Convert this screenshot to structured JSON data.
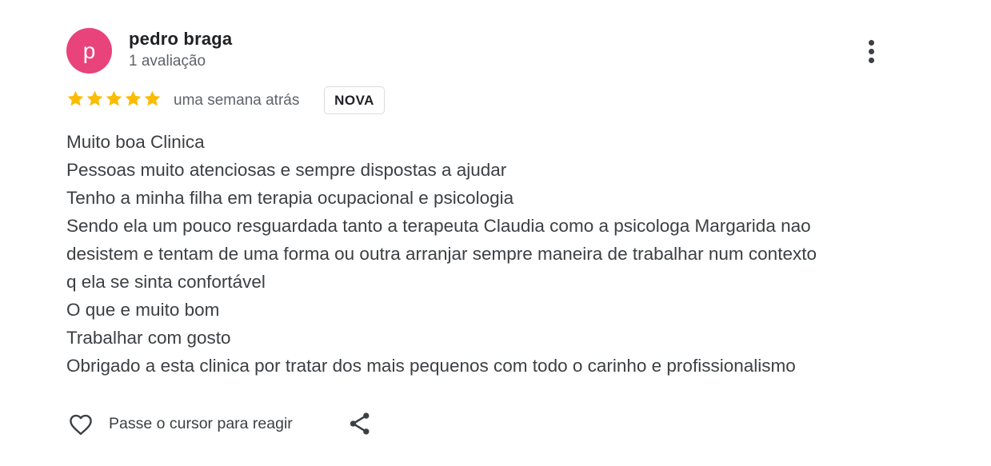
{
  "review": {
    "avatar_letter": "p",
    "avatar_color": "#e8437a",
    "author": "pedro braga",
    "review_count": "1 avaliação",
    "rating": 5,
    "star_color": "#fbbc04",
    "time": "uma semana atrás",
    "badge": "NOVA",
    "text_lines": [
      "Muito boa Clinica",
      "Pessoas muito atenciosas e sempre dispostas a ajudar",
      "Tenho a minha filha em terapia ocupacional e psicologia",
      "Sendo ela um pouco resguardada tanto a terapeuta Claudia como a psicologa Margarida nao",
      "desistem e tentam de uma forma ou outra arranjar sempre maneira de trabalhar num contexto",
      "q ela se sinta confortável",
      "O que e muito bom",
      "Trabalhar com gosto",
      "Obrigado a esta clinica por tratar dos mais pequenos com todo o carinho e profissionalismo"
    ],
    "react_label": "Passe o cursor para reagir",
    "icons": {
      "more": "more-vert-icon",
      "star": "star-icon",
      "react": "heart-icon",
      "share": "share-icon"
    }
  }
}
